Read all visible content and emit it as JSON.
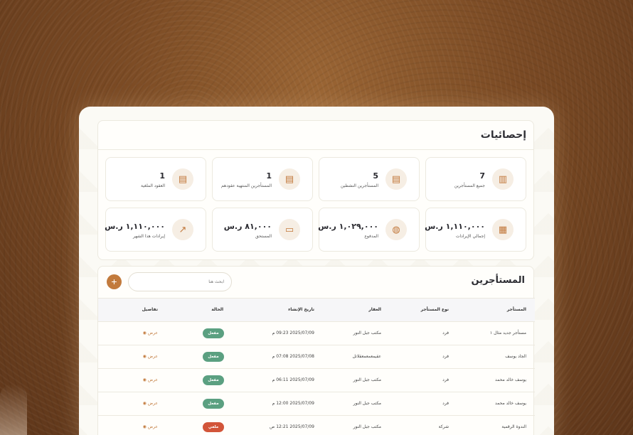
{
  "stats": {
    "title": "إحصائيات",
    "cards": [
      {
        "value": "7",
        "label": "جميع المستأجرين",
        "icon": "building-icon"
      },
      {
        "value": "5",
        "label": "المستأجرين النشطين",
        "icon": "document-check-icon"
      },
      {
        "value": "1",
        "label": "المستأجرين المنتهية عقودهم",
        "icon": "document-warning-icon"
      },
      {
        "value": "1",
        "label": "العقود الملغية",
        "icon": "document-cancel-icon"
      },
      {
        "value": "١,١١٠,٠٠٠ ر.س",
        "label": "إجمالي الإيرادات",
        "icon": "cash-stack-icon"
      },
      {
        "value": "١,٠٢٩,٠٠٠ ر.س",
        "label": "المدفوع",
        "icon": "money-bag-icon"
      },
      {
        "value": "٨١,٠٠٠ ر.س",
        "label": "المستحق",
        "icon": "receipt-icon"
      },
      {
        "value": "١,١١٠,٠٠٠ ر.س",
        "label": "إيرادات هذا الشهر",
        "icon": "trend-up-icon"
      }
    ]
  },
  "tenants": {
    "title": "المستأجرين",
    "search_placeholder": "ابحث هنا",
    "add_label": "+",
    "columns": {
      "tenant": "المستأجر",
      "type": "نوع المستأجر",
      "property": "العقار",
      "created": "تاريخ الإنشاء",
      "status": "الحالة",
      "details": "تفاصيل"
    },
    "rows": [
      {
        "tenant": "مستأجر جديد مثال ١",
        "type": "فرد",
        "property": "مكتب جبل النور",
        "created": "2025/07/09 09:23 م",
        "status": "مفعل",
        "status_kind": "active",
        "details": "عرض"
      },
      {
        "tenant": "الجاد يوسف",
        "type": "فرد",
        "property": "عقيمعمعمعقلاتل",
        "created": "2025/07/08 07:08 م",
        "status": "مفعل",
        "status_kind": "active",
        "details": "عرض"
      },
      {
        "tenant": "يوسف خالد محمد",
        "type": "فرد",
        "property": "مكتب جبل النور",
        "created": "2025/07/09 06:11 م",
        "status": "مفعل",
        "status_kind": "active",
        "details": "عرض"
      },
      {
        "tenant": "يوسف خالد محمد",
        "type": "فرد",
        "property": "مكتب جبل النور",
        "created": "2025/07/09 12:00 م",
        "status": "مفعل",
        "status_kind": "active",
        "details": "عرض"
      },
      {
        "tenant": "الندوة الرقمية",
        "type": "شركة",
        "property": "مكتب جبل النور",
        "created": "2025/07/09 12:21 ص",
        "status": "ملغي",
        "status_kind": "cancel",
        "details": "عرض"
      }
    ]
  },
  "colors": {
    "accent": "#c27a3c",
    "active": "#5ba081",
    "cancel": "#d2553a"
  }
}
